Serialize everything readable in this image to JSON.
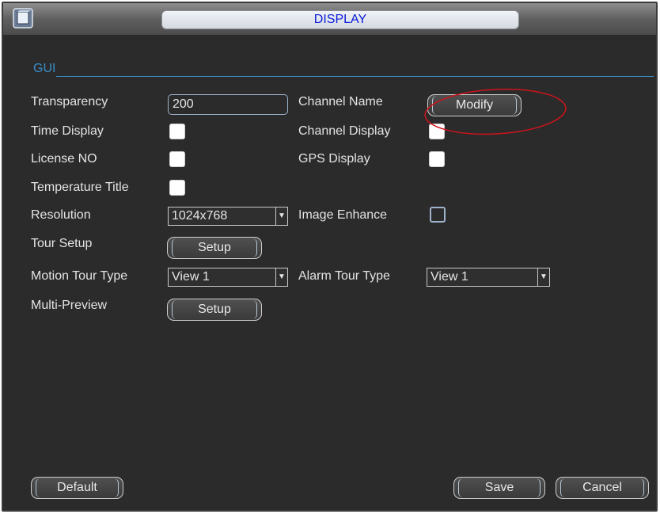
{
  "window": {
    "title": "DISPLAY"
  },
  "gui": {
    "section_label": "GUI"
  },
  "labels": {
    "transparency": "Transparency",
    "channel_name": "Channel Name",
    "time_display": "Time Display",
    "channel_display": "Channel Display",
    "license_no": "License NO",
    "gps_display": "GPS Display",
    "temperature_title": "Temperature Title",
    "resolution": "Resolution",
    "image_enhance": "Image Enhance",
    "tour_setup": "Tour Setup",
    "motion_tour_type": "Motion Tour Type",
    "alarm_tour_type": "Alarm Tour Type",
    "multi_preview": "Multi-Preview"
  },
  "values": {
    "transparency": "200",
    "resolution": "1024x768",
    "motion_tour_type": "View 1",
    "alarm_tour_type": "View 1"
  },
  "checkboxes": {
    "time_display": true,
    "channel_display": true,
    "license_no": true,
    "gps_display": true,
    "temperature_title": true,
    "image_enhance": false
  },
  "buttons": {
    "modify": "Modify",
    "tour_setup": "Setup",
    "multi_preview_setup": "Setup",
    "default": "Default",
    "save": "Save",
    "cancel": "Cancel"
  },
  "colors": {
    "window_bg": "#2b2b2b",
    "title_text": "#0a1bd8",
    "section_accent": "#3a8ec8",
    "annotation_circle": "#d0131b"
  }
}
